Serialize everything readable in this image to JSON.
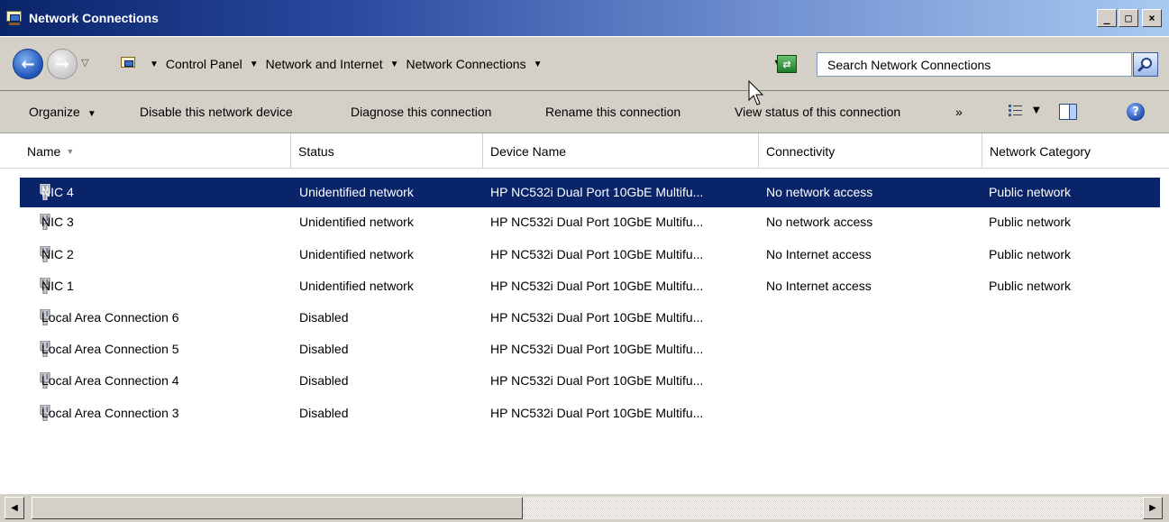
{
  "window": {
    "title": "Network Connections",
    "controls": {
      "minimize": "_",
      "maximize": "□",
      "close": "×"
    }
  },
  "address_bar": {
    "breadcrumbs": [
      "Control Panel",
      "Network and Internet",
      "Network Connections"
    ],
    "search_placeholder": "Search Network Connections"
  },
  "toolbar": {
    "organize_label": "Organize",
    "disable_label": "Disable this network device",
    "diagnose_label": "Diagnose this connection",
    "rename_label": "Rename this connection",
    "view_status_label": "View status of this connection",
    "more_label": "»"
  },
  "columns": [
    "Name",
    "Status",
    "Device Name",
    "Connectivity",
    "Network Category"
  ],
  "rows": [
    {
      "name": "NIC 4",
      "status": "Unidentified network",
      "device": "HP NC532i Dual Port 10GbE Multifu...",
      "connectivity": "No network access",
      "category": "Public network",
      "selected": true
    },
    {
      "name": "NIC 3",
      "status": "Unidentified network",
      "device": "HP NC532i Dual Port 10GbE Multifu...",
      "connectivity": "No network access",
      "category": "Public network"
    },
    {
      "name": "NIC 2",
      "status": "Unidentified network",
      "device": "HP NC532i Dual Port 10GbE Multifu...",
      "connectivity": "No Internet access",
      "category": "Public network"
    },
    {
      "name": "NIC 1",
      "status": "Unidentified network",
      "device": "HP NC532i Dual Port 10GbE Multifu...",
      "connectivity": "No Internet access",
      "category": "Public network"
    },
    {
      "name": "Local Area Connection 6",
      "status": "Disabled",
      "device": "HP NC532i Dual Port 10GbE Multifu...",
      "connectivity": "",
      "category": ""
    },
    {
      "name": "Local Area Connection 5",
      "status": "Disabled",
      "device": "HP NC532i Dual Port 10GbE Multifu...",
      "connectivity": "",
      "category": ""
    },
    {
      "name": "Local Area Connection 4",
      "status": "Disabled",
      "device": "HP NC532i Dual Port 10GbE Multifu...",
      "connectivity": "",
      "category": ""
    },
    {
      "name": "Local Area Connection 3",
      "status": "Disabled",
      "device": "HP NC532i Dual Port 10GbE Multifu...",
      "connectivity": "",
      "category": ""
    }
  ],
  "colors": {
    "selection": "#0a246a",
    "chrome": "#d4d0c8",
    "title_gradient_start": "#0a246a",
    "title_gradient_end": "#a6caf0"
  },
  "icons": {
    "title": "network-connections-icon",
    "back": "back-arrow-icon",
    "forward": "forward-arrow-icon",
    "go": "go-refresh-icon",
    "search": "search-icon",
    "views": "views-icon",
    "preview_pane": "preview-pane-icon",
    "help": "help-icon",
    "nic": "network-adapter-icon"
  }
}
